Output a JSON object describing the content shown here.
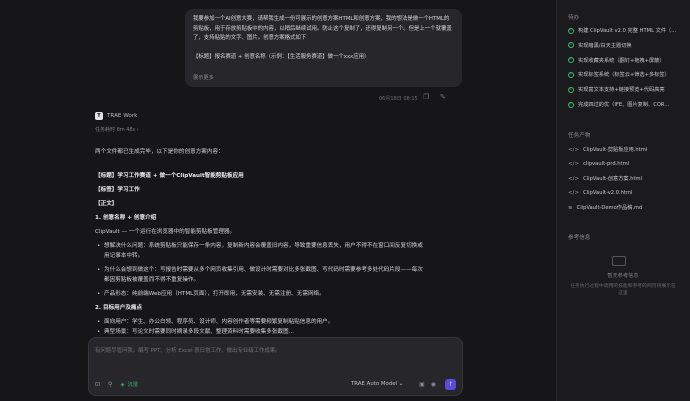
{
  "user_message": {
    "text": "我要参加一个AI创意大赛，请帮我生成一份可展示的创意方案HTML和创意方案，我的想法是做一个HTML的剪贴板，用于存放剪贴板中的内容，以稍后继续试用。防止这个复制了，还得复制另一个。但是上一个就覆盖了，支持粘贴的文字、图片。创意方案格式如下\n\n【标题】报名赛道 + 创意名称（示例：【生活服务赛道】做一个xxx应用）",
    "show_more": "展示更多",
    "timestamp": "06月18日 08:15"
  },
  "assistant": {
    "name": "TRAE Work",
    "elapsed": "任务耗时 8m 48s",
    "lines": [
      {
        "text": "两个文件都已生成完毕，以下是你的创意方案内容：",
        "bold": false,
        "bullet": false
      },
      {
        "text": "【标题】学习工作赛道 + 做一个ClipVault智能剪贴板应用",
        "bold": true,
        "bullet": false
      },
      {
        "text": "【标签】学习工作",
        "bold": true,
        "bullet": false
      },
      {
        "text": "【正文】",
        "bold": true,
        "bullet": false
      },
      {
        "text": "1. 创意名称 + 创意介绍",
        "bold": true,
        "bullet": false
      },
      {
        "text": "ClipVault — 一个运行在浏览器中的智能剪贴板管理器。",
        "bold": false,
        "bullet": false
      },
      {
        "text": "想解决什么问题：系统剪贴板只能保存一条内容，复制新内容会覆盖旧内容，导致重要信息丢失，用户不得不在窗口间反复切换或",
        "bold": false,
        "bullet": true
      },
      {
        "text": "用记事本中转。",
        "bold": false,
        "bullet": false,
        "indent": true
      },
      {
        "text": "为什么会想到做这个：写报告时需要从多个网页收集引用、做设计时需要对比多张截图、写代码时需要参考多处代码片段——每次",
        "bold": false,
        "bullet": true
      },
      {
        "text": "都因剪贴板被覆盖而不得不重复操作。",
        "bold": false,
        "bullet": false,
        "indent": true
      },
      {
        "text": "产品形态：纯前端Web应用（HTML页面），打开即用，无需安装、无需注册、无需网络。",
        "bold": false,
        "bullet": true
      },
      {
        "text": "2. 目标用户及痛点",
        "bold": true,
        "bullet": false
      },
      {
        "text": "面向用户：学生、办公白领、程序员、设计师、内容创作者等需要频繁复制粘贴信息的用户。",
        "bold": false,
        "bullet": true
      },
      {
        "text": "典型场景：写论文时需要同时摘录多段文献、整理资料时需要收集多张截图...",
        "bold": false,
        "bullet": true
      }
    ]
  },
  "input": {
    "placeholder": "有问题尽管问我，编写 PPT、分析 Excel 表日常工作、做出专业级工作成果。",
    "mode_label": "沉浸",
    "model_label": "TRAE Auto Model",
    "send_icon": "arrow-up-icon"
  },
  "right_panel": {
    "todo_title": "待办",
    "todos": [
      "构建 ClipVault v2.0 完整 HTML 文件（...",
      "实现暗黑/白天主题切换",
      "实现收藏夹系统（翻钉+拖拽+屏蔽）",
      "实现标签系统（标签云+筛选+多标签）",
      "实现富文本支持+链接预览+代码高亮",
      "完成四过的优（IFE、图片复制、COR..."
    ],
    "files_title": "任务产物",
    "files": [
      "ClipVault-剪贴板应用.html",
      "clipvault-prd.html",
      "ClipVault-创意方案.html",
      "ClipVault-v2.0.html",
      "ClipVault-Demo作品稿.md"
    ],
    "ref_title": "参考信息",
    "ref_empty_title": "暂无参考信息",
    "ref_empty_sub": "任务执行过程中调用的技能和参考的网页将展示在这里"
  }
}
